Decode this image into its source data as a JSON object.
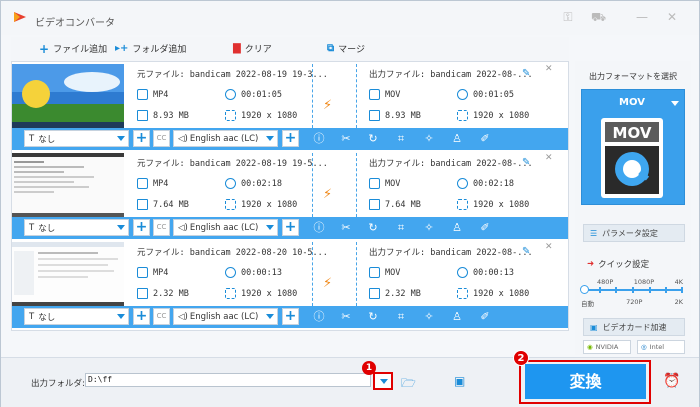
{
  "app": {
    "title": "ビデオコンバータ"
  },
  "toolbar": {
    "add_file": "ファイル追加",
    "add_folder": "フォルダ追加",
    "clear": "クリア",
    "merge": "マージ"
  },
  "files": [
    {
      "src_name": "元ファイル: bandicam 2022-08-19 19-3...",
      "dst_name": "出力ファイル: bandicam 2022-08-...",
      "src_format": "MP4",
      "src_duration": "00:01:05",
      "src_size": "8.93 MB",
      "src_resolution": "1920 x 1080",
      "dst_format": "MOV",
      "dst_duration": "00:01:05",
      "dst_size": "8.93 MB",
      "dst_resolution": "1920 x 1080",
      "subtitle": "なし",
      "audio": "English aac (LC)"
    },
    {
      "src_name": "元ファイル: bandicam 2022-08-19 19-5...",
      "dst_name": "出力ファイル: bandicam 2022-08-...",
      "src_format": "MP4",
      "src_duration": "00:02:18",
      "src_size": "7.64 MB",
      "src_resolution": "1920 x 1080",
      "dst_format": "MOV",
      "dst_duration": "00:02:18",
      "dst_size": "7.64 MB",
      "dst_resolution": "1920 x 1080",
      "subtitle": "なし",
      "audio": "English aac (LC)"
    },
    {
      "src_name": "元ファイル: bandicam 2022-08-20 10-5...",
      "dst_name": "出力ファイル: bandicam 2022-08-...",
      "src_format": "MP4",
      "src_duration": "00:00:13",
      "src_size": "2.32 MB",
      "src_resolution": "1920 x 1080",
      "dst_format": "MOV",
      "dst_duration": "00:00:13",
      "dst_size": "2.32 MB",
      "dst_resolution": "1920 x 1080",
      "subtitle": "なし",
      "audio": "English aac (LC)"
    }
  ],
  "right_panel": {
    "title": "出力フォーマットを選択",
    "format": "MOV",
    "format_icon_text": "MOV",
    "param_button": "パラメータ設定",
    "quick_label": "クイック設定",
    "slider_top": [
      "480P",
      "1080P",
      "4K"
    ],
    "slider_bottom": [
      "自動",
      "720P",
      "2K"
    ],
    "gpu_button": "ビデオカード加速",
    "vendors": [
      "NVIDIA",
      "Intel"
    ]
  },
  "bottom": {
    "output_label": "出力フォルダ:",
    "output_path": "D:\\ff",
    "convert_label": "変換",
    "badge1": "1",
    "badge2": "2"
  },
  "colors": {
    "accent": "#43a6ef",
    "convert": "#1e96f0",
    "highlight": "#e00000",
    "speed": "#f08a1c"
  }
}
